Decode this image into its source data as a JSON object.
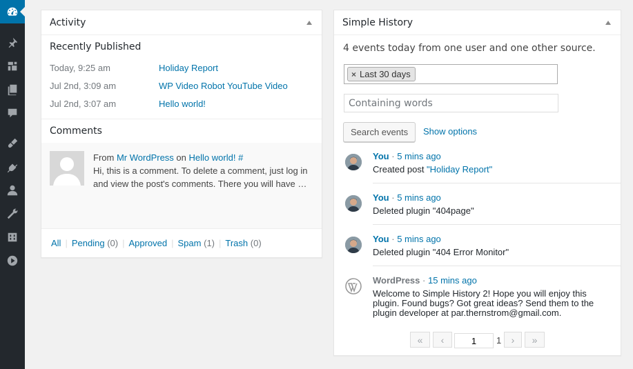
{
  "activity": {
    "title": "Activity",
    "recently_published_title": "Recently Published",
    "recently_published": [
      {
        "date": "Today, 9:25 am",
        "title": "Holiday Report"
      },
      {
        "date": "Jul 2nd, 3:09 am",
        "title": "WP Video Robot YouTube Video"
      },
      {
        "date": "Jul 2nd, 3:07 am",
        "title": "Hello world!"
      }
    ],
    "comments_title": "Comments",
    "comment": {
      "from_label": "From",
      "author": "Mr WordPress",
      "on_label": "on",
      "post": "Hello world!",
      "hash": "#",
      "text": "Hi, this is a comment. To delete a comment, just log in and view the post's comments. There you will have …"
    },
    "filter_links": [
      {
        "label": "All",
        "count": ""
      },
      {
        "label": "Pending",
        "count": "(0)"
      },
      {
        "label": "Approved",
        "count": ""
      },
      {
        "label": "Spam",
        "count": "(1)"
      },
      {
        "label": "Trash",
        "count": "(0)"
      }
    ]
  },
  "simple_history": {
    "title": "Simple History",
    "summary": "4 events today from one user and one other source.",
    "date_chip": "Last 30 days",
    "chip_remove": "×",
    "words_placeholder": "Containing words",
    "search_button": "Search events",
    "show_options": "Show options",
    "events": [
      {
        "who": "You",
        "sep": "·",
        "when": "5 mins ago",
        "message": "Created post ",
        "link": "\"Holiday Report\""
      },
      {
        "who": "You",
        "sep": "·",
        "when": "5 mins ago",
        "message": "Deleted plugin \"404page\"",
        "link": ""
      },
      {
        "who": "You",
        "sep": "·",
        "when": "5 mins ago",
        "message": "Deleted plugin \"404 Error Monitor\"",
        "link": ""
      },
      {
        "who": "WordPress",
        "sep": "·",
        "when": "15 mins ago",
        "message": "Welcome to Simple History 2! Hope you will enjoy this plugin. Found bugs? Got great ideas? Send them to the plugin developer at par.thernstrom@gmail.com.",
        "link": ""
      }
    ],
    "pagination": {
      "first": "«",
      "prev": "‹",
      "current": "1",
      "total": "1",
      "next": "›",
      "last": "»"
    }
  },
  "sidebar": {
    "icons": [
      "dashboard-icon",
      "pin-icon",
      "media-icon",
      "pages-icon",
      "comments-icon",
      "appearance-icon",
      "plugins-icon",
      "users-icon",
      "tools-icon",
      "settings-icon",
      "video-icon"
    ]
  }
}
